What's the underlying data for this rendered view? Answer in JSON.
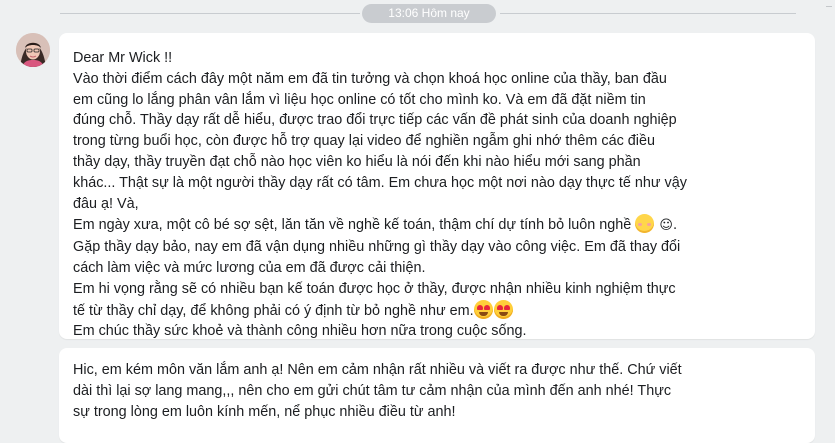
{
  "conversation": {
    "timestamp": "13:06 Hôm nay",
    "messages": [
      {
        "lines": [
          "Dear Mr Wick !!",
          "Vào thời điểm cách đây một năm em đã tin tưởng và chọn khoá học online của thầy, ban đầu",
          "em cũng lo lắng phân vân lắm vì liệu học online có tốt cho mình ko. Và em đã đặt niềm tin",
          "đúng chỗ. Thầy dạy rất dễ hiểu, được trao đổi trực tiếp các vấn đề phát sinh của doanh nghiệp",
          "trong từng buổi học, còn được hỗ trợ quay lại video để nghiền ngẫm ghi nhớ thêm các điều",
          "thầy dạy, thầy truyền đạt chỗ nào học viên ko hiểu là nói đến khi nào hiểu mới sang phần",
          "khác... Thật sự là một người thầy dạy rất có tâm. Em chưa học một nơi nào dạy thực tế như vậy",
          "đâu ạ! Và,",
          "Em ngày xưa, một cô bé sợ sệt, lăn tăn về nghề kế toán, thậm chí dự tính bỏ luôn nghề",
          "Gặp thầy dạy bảo, nay em đã vận dụng nhiều những gì thầy dạy vào công việc. Em đã thay đổi",
          "cách làm việc và mức lương của em đã được cải thiện.",
          " Em hi vọng rằng sẽ có nhiều bạn kế toán được học ở thầy, được nhận nhiều kinh nghiệm thực",
          "tế từ thầy chỉ dạy, để không phải có ý định từ bỏ nghề như em.",
          "Em chúc thầy sức khoẻ và thành công nhiều hơn nữa trong cuộc sống."
        ],
        "line9_tail": " ☺.",
        "emoji_after_line9": "smiling-face-with-blush",
        "emoji_after_line13": [
          "smiling-face-with-heart-eyes",
          "smiling-face-with-heart-eyes"
        ]
      },
      {
        "lines": [
          "Hic, em kém môn văn lắm anh ạ! Nên em cảm nhận rất nhiều và viết ra được như thế. Chứ viết",
          "dài thì lại sợ lang mang,,, nên cho em gửi chút tâm tư cảm nhận của mình đến anh nhé! Thực",
          "sự trong lòng em luôn kính mến, nể phục nhiều điều từ anh!"
        ]
      }
    ]
  }
}
